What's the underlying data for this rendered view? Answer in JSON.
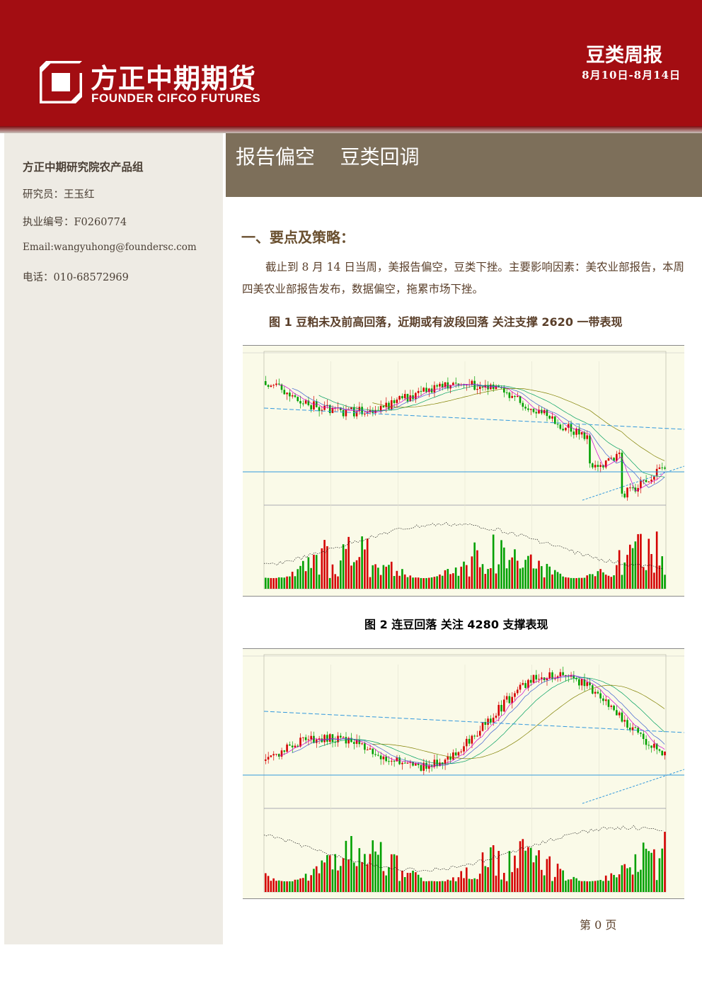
{
  "header": {
    "company_cn": "方正中期期货",
    "company_en": "FOUNDER CIFCO FUTURES",
    "report_type": "豆类周报",
    "date_range": "8月10日-8月14日"
  },
  "sidebar": {
    "team": "方正中期研究院农产品组",
    "analyst": "研究员：王玉红",
    "license": "执业编号：F0260774",
    "email": "Email:wangyuhong@foundersc.com",
    "phone": "电话：010-68572969"
  },
  "banner": {
    "title": "报告偏空    豆类回调"
  },
  "section": {
    "heading": "一、要点及策略：",
    "paragraph": "截止到 8 月 14 日当周，美报告偏空，豆类下挫。主要影响因素：美农业部报告，本周四美农业部报告发布，数据偏空，拖累市场下挫。"
  },
  "figure1": {
    "caption": "图 1 豆粕未及前高回落，近期或有波段回落 关注支撑 2620 一带表现",
    "colors": {
      "up": "#d40000",
      "down": "#00a000",
      "bg": "#fafae8"
    }
  },
  "figure2": {
    "caption": "图 2  连豆回落  关注 4280 支撑表现",
    "colors": {
      "up": "#d40000",
      "down": "#00a000",
      "bg": "#fafae8"
    }
  },
  "footer": {
    "page": "第 0 页"
  }
}
